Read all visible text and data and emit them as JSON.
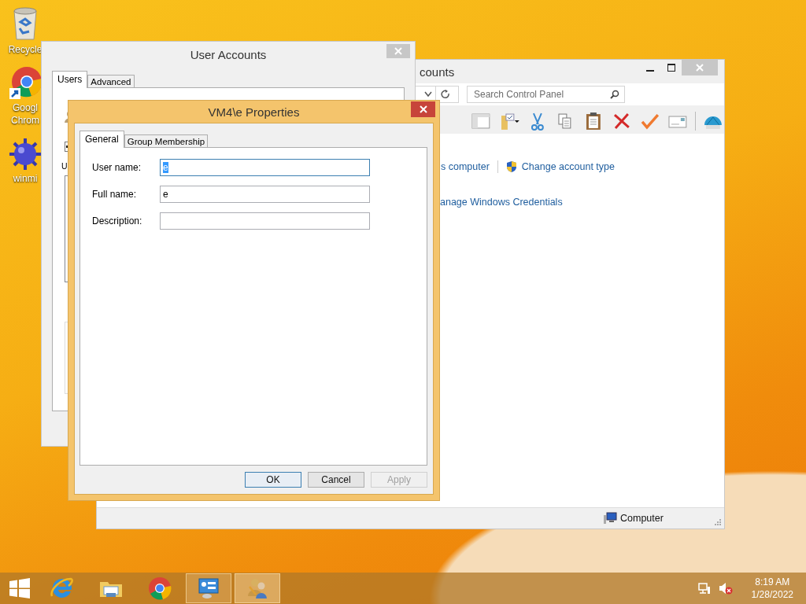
{
  "desktop_icons": [
    {
      "kind": "recycle",
      "label_lines": [
        "Recycle"
      ]
    },
    {
      "kind": "chrome",
      "label_lines": [
        "Googl",
        "Chrom"
      ]
    },
    {
      "kind": "mine",
      "label_lines": [
        "winmi"
      ]
    }
  ],
  "control_panel_window": {
    "title": "counts",
    "search": {
      "placeholder": "Search Control Panel"
    },
    "links": [
      {
        "text": "s computer",
        "shield": false
      },
      {
        "text": "Change account type",
        "shield": true
      },
      {
        "text": "anage Windows Credentials",
        "shield": false
      }
    ],
    "status_bar": {
      "text": "Computer"
    }
  },
  "user_accounts_window": {
    "title": "User Accounts",
    "tabs": [
      {
        "label": "Users",
        "selected": true
      },
      {
        "label": "Advanced",
        "selected": false
      }
    ],
    "checkbox": {
      "checked": true
    },
    "label_fragment": "U"
  },
  "properties_dialog": {
    "title": "VM4\\e Properties",
    "tabs": [
      {
        "label": "General",
        "selected": true
      },
      {
        "label": "Group Membership",
        "selected": false
      }
    ],
    "fields": [
      {
        "label": "User name:",
        "value": "e",
        "focused": true
      },
      {
        "label": "Full name:",
        "value": "e",
        "focused": false
      },
      {
        "label": "Description:",
        "focused": false
      }
    ],
    "buttons": [
      {
        "label": "OK",
        "default": true,
        "disabled": false
      },
      {
        "label": "Cancel",
        "default": false,
        "disabled": false
      },
      {
        "label": "Apply",
        "default": false,
        "disabled": true
      }
    ]
  },
  "taskbar": {
    "apps": [
      {
        "kind": "ie",
        "open": false,
        "selected": false
      },
      {
        "kind": "explorer",
        "open": false,
        "selected": false
      },
      {
        "kind": "chrome",
        "open": false,
        "selected": false
      },
      {
        "kind": "control-panel",
        "open": true,
        "selected": false
      },
      {
        "kind": "users",
        "open": true,
        "selected": true
      }
    ],
    "clock": {
      "time": "8:19 AM",
      "date": "1/28/2022"
    }
  }
}
